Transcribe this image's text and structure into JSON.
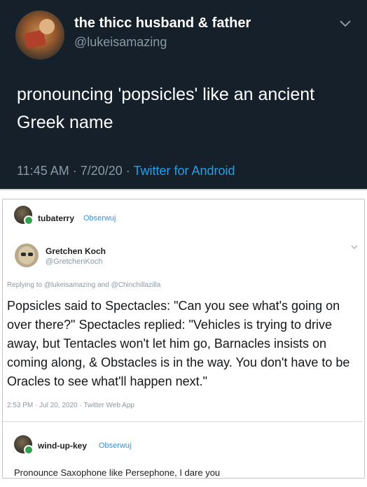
{
  "tweet": {
    "display_name": "the thicc husband & father",
    "handle": "@lukeisamazing",
    "text": "pronouncing 'popsicles' like an ancient Greek name",
    "time_date": "11:45 AM · 7/20/20 · ",
    "source": "Twitter for Android"
  },
  "comments": [
    {
      "name": "tubaterry",
      "tag": "Obserwuj"
    },
    {
      "name": "wind-up-key",
      "tag": "Obserwuj",
      "text": "Pronounce Saxophone like Persephone, I dare you"
    }
  ],
  "quoted": {
    "display_name": "Gretchen Koch",
    "handle": "@GretchenKoch",
    "replying_prefix": "Replying to ",
    "replying_to_1": "@lukeisamazing",
    "replying_and": " and ",
    "replying_to_2": "@Chinchillazilla",
    "text": "Popsicles said to Spectacles: \"Can you see what's going on over there?\" Spectacles replied: \"Vehicles is trying to drive away, but Tentacles won't let him go, Barnacles insists on coming along, & Obstacles is in the way. You don't have to be Oracles to see what'll happen next.\"",
    "meta": "2:53 PM · Jul 20, 2020 · Twitter Web App"
  },
  "colors": {
    "dark_bg": "#15202b",
    "link_blue": "#1da1f2",
    "muted": "#8899a6",
    "online_green": "#31a24c"
  }
}
